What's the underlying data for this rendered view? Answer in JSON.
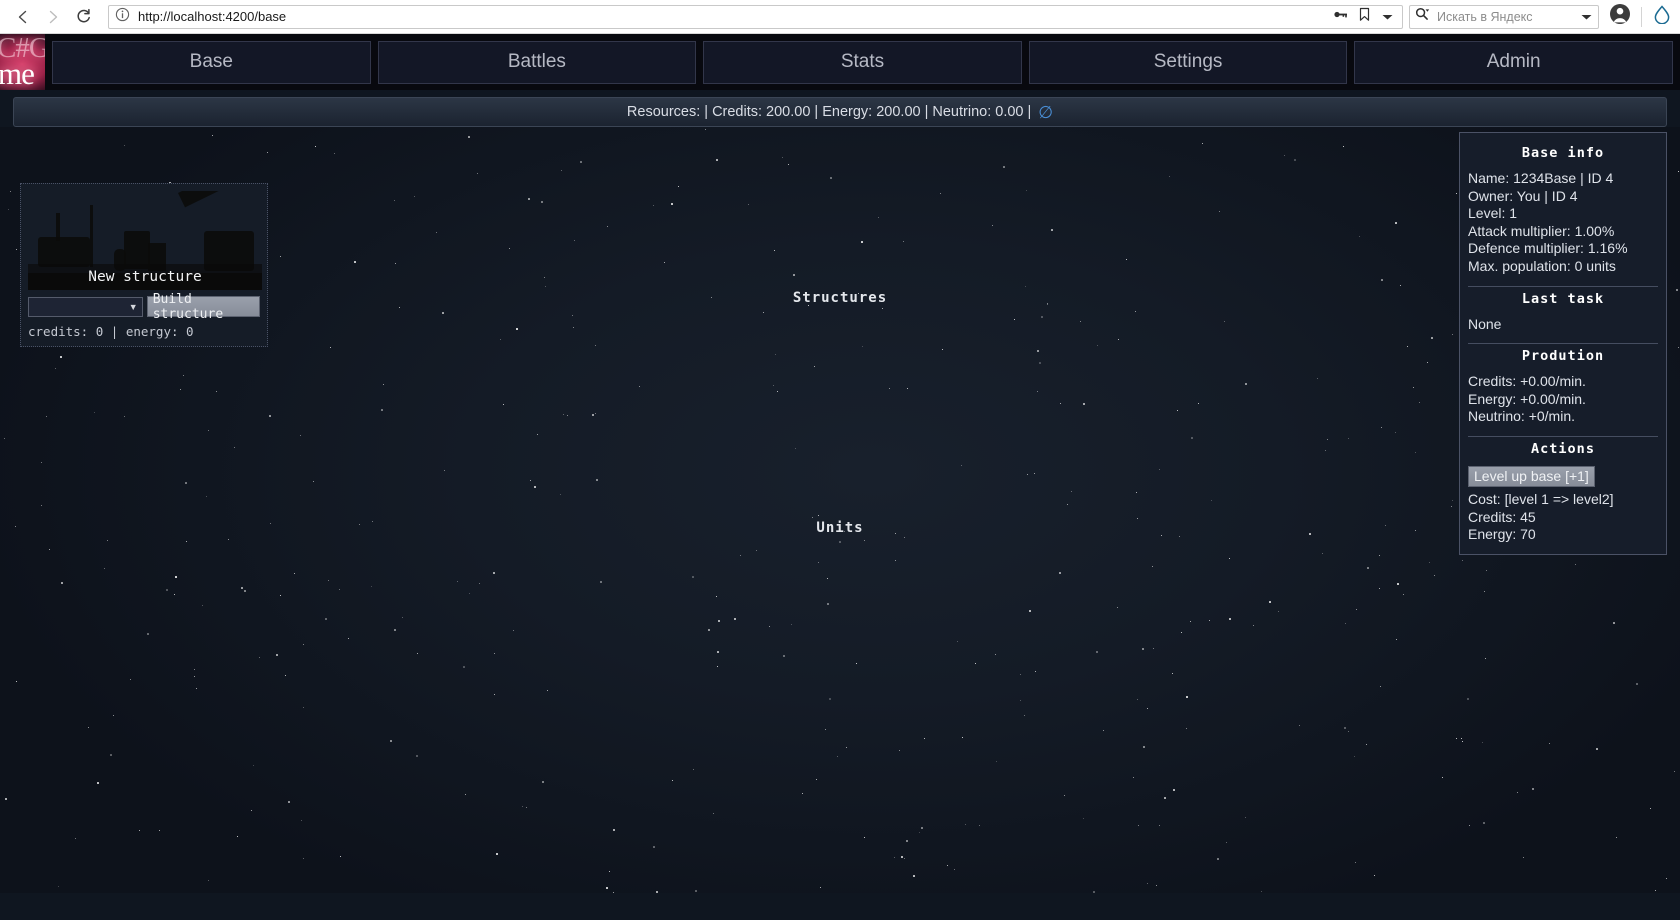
{
  "browser": {
    "back_icon": "back-arrow-icon",
    "forward_icon": "forward-arrow-icon",
    "reload_icon": "reload-icon",
    "site_info_icon": "info-circle-icon",
    "url": "http://localhost:4200/base",
    "key_icon": "password-key-icon",
    "bookmark_icon": "bookmark-icon",
    "dropdown_icon": "chevron-down-icon",
    "search_engine_icon": "search-icon",
    "search_placeholder": "Искать в Яндекс",
    "search_dropdown_icon": "chevron-down-icon",
    "profile_icon": "user-avatar-icon",
    "browser_brand_icon": "yandex-brand-icon"
  },
  "app": {
    "logo_line1": "C#Ga",
    "logo_line2": "me",
    "nav_tabs": [
      {
        "label": "Base"
      },
      {
        "label": "Battles"
      },
      {
        "label": "Stats"
      },
      {
        "label": "Settings"
      },
      {
        "label": "Admin"
      }
    ]
  },
  "resources": {
    "text": "Resources: | Credits: 200.00 | Energy: 200.00 | Neutrino: 0.00 |",
    "neutrino_symbol": "∅",
    "neutrino_color": "#4a8fd6"
  },
  "sections": {
    "structures_heading": "Structures",
    "units_heading": "Units"
  },
  "structure_card": {
    "thumb_caption": "New structure",
    "select_value": "",
    "select_arrow": "▼",
    "build_label": "Build structure",
    "cost_text": "credits: 0 | energy: 0"
  },
  "info_panel": {
    "base_info_title": "Base info",
    "base_info_lines": [
      "Name: 1234Base | ID 4",
      "Owner: You | ID 4",
      "Level: 1",
      "Attack multiplier: 1.00%",
      "Defence multiplier: 1.16%",
      "Max. population: 0 units"
    ],
    "last_task_title": "Last task",
    "last_task_value": "None",
    "production_title": "Prodution",
    "production_lines": [
      "Credits: +0.00/min.",
      "Energy: +0.00/min.",
      "Neutrino: +0/min."
    ],
    "actions_title": "Actions",
    "levelup_label": "Level up base [+1]",
    "cost_lines": [
      "Cost: [level 1 => level2]",
      "Credits: 45",
      "Energy: 70"
    ]
  }
}
